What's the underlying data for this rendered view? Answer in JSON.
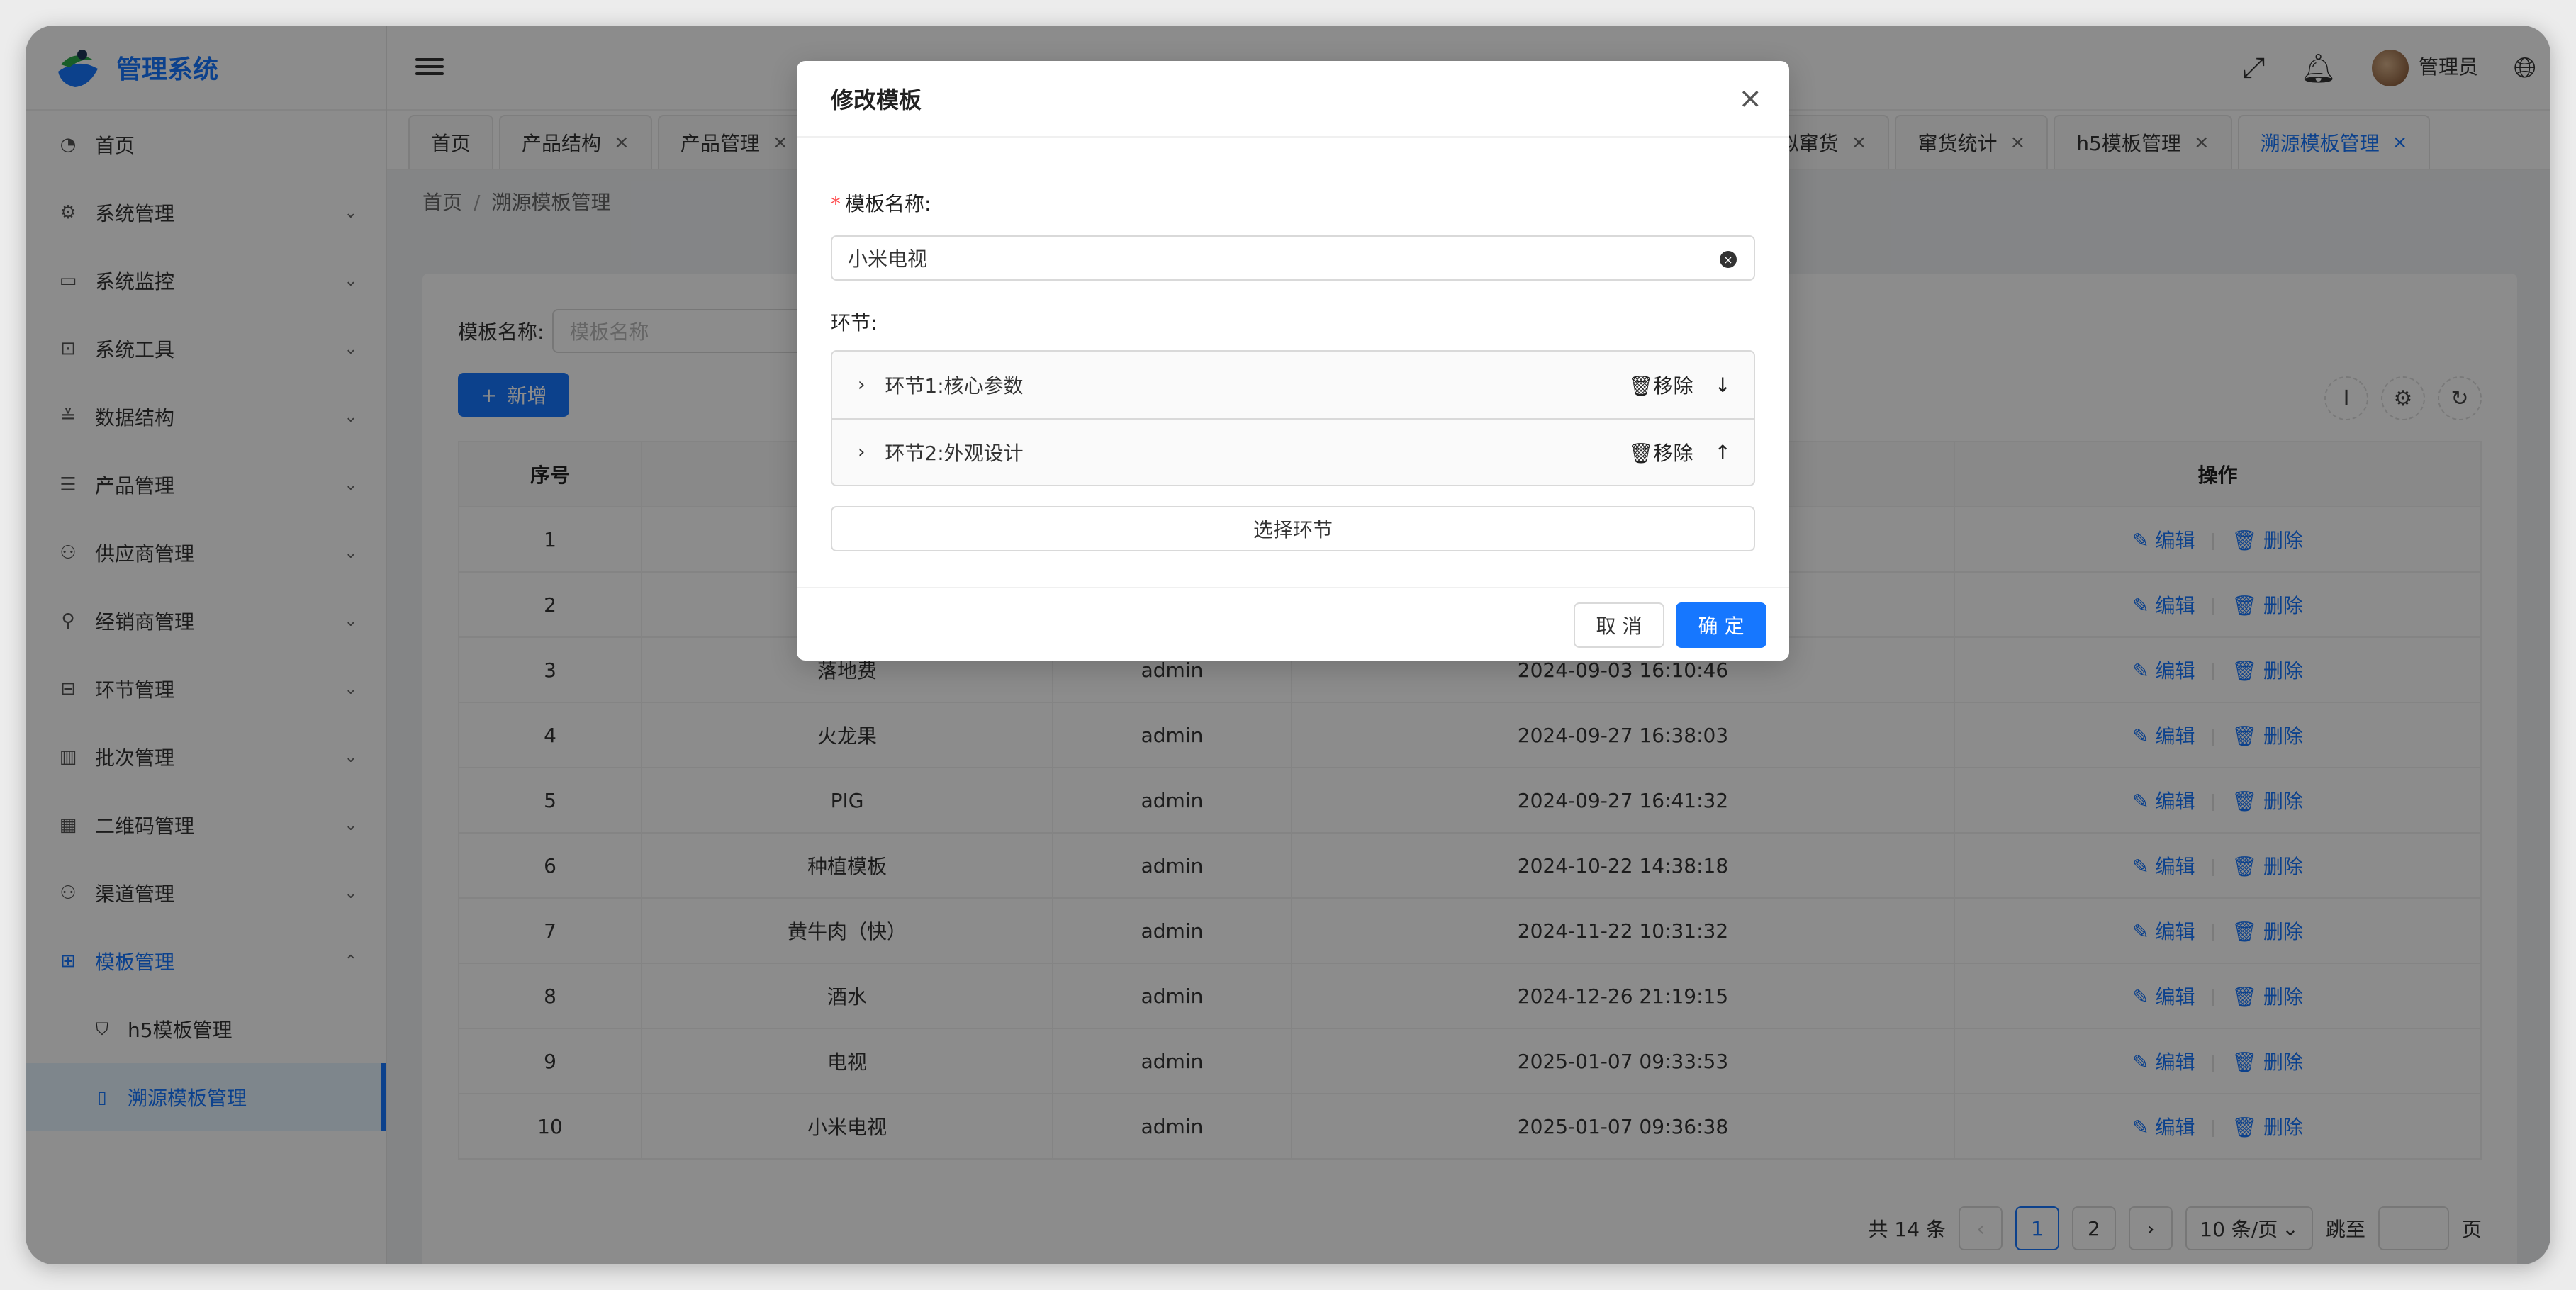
{
  "app": {
    "title": "管理系统"
  },
  "sidebar": {
    "items": [
      {
        "label": "首页",
        "icon": "dashboard-icon",
        "glyph": "◔"
      },
      {
        "label": "系统管理",
        "icon": "gear-icon",
        "glyph": "⚙"
      },
      {
        "label": "系统监控",
        "icon": "monitor-icon",
        "glyph": "▭"
      },
      {
        "label": "系统工具",
        "icon": "toolbox-icon",
        "glyph": "⊡"
      },
      {
        "label": "数据结构",
        "icon": "sliders-icon",
        "glyph": "≚"
      },
      {
        "label": "产品管理",
        "icon": "list-icon",
        "glyph": "☰"
      },
      {
        "label": "供应商管理",
        "icon": "team-icon",
        "glyph": "⚇"
      },
      {
        "label": "经销商管理",
        "icon": "user-icon",
        "glyph": "⚲"
      },
      {
        "label": "环节管理",
        "icon": "stage-icon",
        "glyph": "⊟"
      },
      {
        "label": "批次管理",
        "icon": "barcode-icon",
        "glyph": "▥"
      },
      {
        "label": "二维码管理",
        "icon": "qrcode-icon",
        "glyph": "▦"
      },
      {
        "label": "渠道管理",
        "icon": "channel-icon",
        "glyph": "⚇"
      },
      {
        "label": "模板管理",
        "icon": "template-icon",
        "glyph": "⊞"
      }
    ],
    "subitems": [
      {
        "label": "h5模板管理",
        "icon": "html5-icon",
        "glyph": "⛉"
      },
      {
        "label": "溯源模板管理",
        "icon": "file-icon",
        "glyph": "▯"
      }
    ]
  },
  "header": {
    "user": "管理员"
  },
  "tabs": [
    {
      "label": "首页",
      "closable": false
    },
    {
      "label": "产品结构",
      "closable": true
    },
    {
      "label": "产品管理",
      "closable": true
    },
    {
      "label": "疑似窜货",
      "closable": true
    },
    {
      "label": "窜货统计",
      "closable": true
    },
    {
      "label": "h5模板管理",
      "closable": true
    },
    {
      "label": "溯源模板管理",
      "closable": true,
      "active": true
    }
  ],
  "breadcrumb": {
    "home": "首页",
    "current": "溯源模板管理"
  },
  "search": {
    "label": "模板名称:",
    "placeholder": "模板名称"
  },
  "toolbar": {
    "add_label": "新增"
  },
  "table": {
    "headers": [
      "序号",
      "",
      "",
      "",
      "操作"
    ],
    "rows": [
      {
        "no": "1",
        "name": "",
        "creator": "",
        "time": ""
      },
      {
        "no": "2",
        "name": "",
        "creator": "",
        "time": ""
      },
      {
        "no": "3",
        "name": "落地费",
        "creator": "admin",
        "time": "2024-09-03 16:10:46"
      },
      {
        "no": "4",
        "name": "火龙果",
        "creator": "admin",
        "time": "2024-09-27 16:38:03"
      },
      {
        "no": "5",
        "name": "PIG",
        "creator": "admin",
        "time": "2024-09-27 16:41:32"
      },
      {
        "no": "6",
        "name": "种植模板",
        "creator": "admin",
        "time": "2024-10-22 14:38:18"
      },
      {
        "no": "7",
        "name": "黄牛肉（快）",
        "creator": "admin",
        "time": "2024-11-22 10:31:32"
      },
      {
        "no": "8",
        "name": "酒水",
        "creator": "admin",
        "time": "2024-12-26 21:19:15"
      },
      {
        "no": "9",
        "name": "电视",
        "creator": "admin",
        "time": "2025-01-07 09:33:53"
      },
      {
        "no": "10",
        "name": "小米电视",
        "creator": "admin",
        "time": "2025-01-07 09:36:38"
      }
    ],
    "edit_label": "编辑",
    "delete_label": "删除"
  },
  "pagination": {
    "total": "共 14 条",
    "pages": [
      "1",
      "2"
    ],
    "current": "1",
    "page_size": "10 条/页",
    "jump_label": "跳至",
    "page_suffix": "页"
  },
  "modal": {
    "title": "修改模板",
    "name_label": "模板名称:",
    "name_value": "小米电视",
    "stages_label": "环节:",
    "stages": [
      {
        "label": "环节1:核心参数",
        "remove": "移除",
        "move": "↓"
      },
      {
        "label": "环节2:外观设计",
        "remove": "移除",
        "move": "↑"
      }
    ],
    "select_stage_label": "选择环节",
    "cancel_label": "取 消",
    "ok_label": "确 定"
  },
  "colors": {
    "primary": "#1677ff",
    "required": "#ff4d4f"
  }
}
